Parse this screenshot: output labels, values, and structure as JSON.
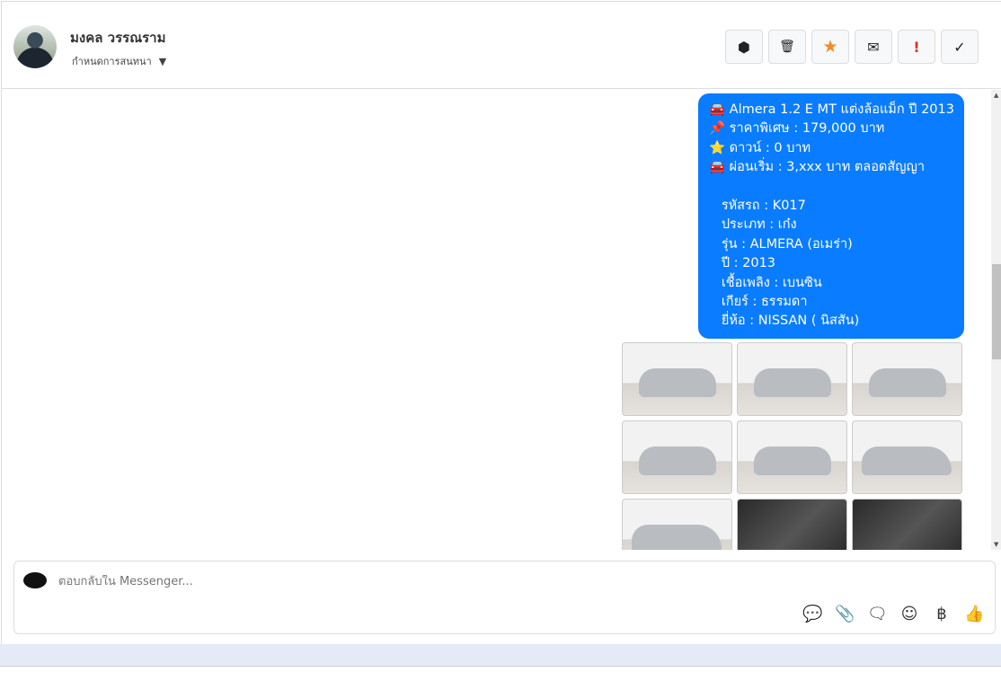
{
  "header": {
    "contact_name": "มงคล วรรณราม",
    "assign_label": "กำหนดการสนทนา",
    "actions": [
      {
        "icon": "alert-circle-icon",
        "glyph": "⬢"
      },
      {
        "icon": "trash-icon",
        "glyph": "🗑"
      },
      {
        "icon": "star-icon",
        "glyph": "★",
        "color": "#f28c28"
      },
      {
        "icon": "envelope-icon",
        "glyph": "✉"
      },
      {
        "icon": "exclamation-icon",
        "glyph": "!",
        "color": "#d93025"
      },
      {
        "icon": "check-icon",
        "glyph": "✓"
      }
    ]
  },
  "message": {
    "text": "🚘 Almera 1.2 E MT แต่งล้อแม็ก ปี 2013\n📌 ราคาพิเศษ : 179,000 บาท\n⭐ ดาวน์ : 0 บาท\n🚘 ผ่อนเริ่ม : 3,xxx บาท ตลอดสัญญา\n\n   รหัสรถ : K017\n   ประเภท : เก๋ง\n   รุ่น : ALMERA (อเมร่า)\n   ปี : 2013\n   เชื้อเพลิง : เบนซิน\n   เกียร์ : ธรรมดา\n   ยี่ห้อ : NISSAN ( นิสสัน)",
    "bubble_color": "#0a7cff",
    "photo_count": 9
  },
  "composer": {
    "placeholder": "ตอบกลับใน Messenger...",
    "tools": [
      {
        "icon": "saved-reply-icon",
        "glyph": "💬"
      },
      {
        "icon": "paperclip-icon",
        "glyph": "📎"
      },
      {
        "icon": "chat-dots-icon",
        "glyph": "🗨"
      },
      {
        "icon": "smiley-icon",
        "glyph": "☺"
      },
      {
        "icon": "baht-icon",
        "glyph": "฿"
      },
      {
        "icon": "thumbs-up-icon",
        "glyph": "👍"
      }
    ]
  }
}
